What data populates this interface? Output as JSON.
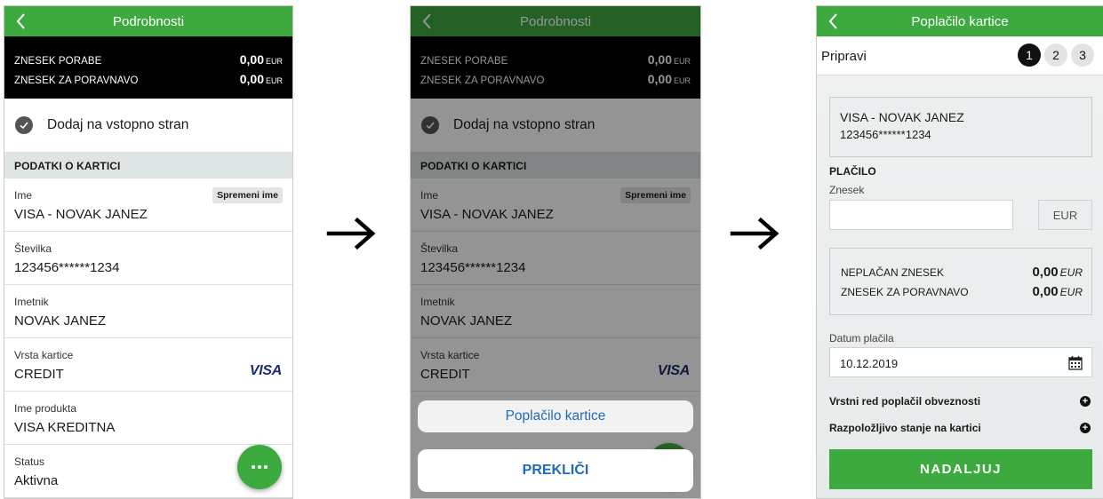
{
  "screen1": {
    "title": "Podrobnosti",
    "summary": [
      {
        "label": "ZNESEK PORABE",
        "value": "0,00",
        "currency": "EUR"
      },
      {
        "label": "ZNESEK ZA PORAVNAVO",
        "value": "0,00",
        "currency": "EUR"
      }
    ],
    "add_to_home": "Dodaj na vstopno stran",
    "section_title": "PODATKI O KARTICI",
    "rename_label": "Spremeni ime",
    "card_brand": "VISA",
    "fields": [
      {
        "label": "Ime",
        "value": "VISA - NOVAK JANEZ"
      },
      {
        "label": "Številka",
        "value": "123456******1234"
      },
      {
        "label": "Imetnik",
        "value": "NOVAK JANEZ"
      },
      {
        "label": "Vrsta kartice",
        "value": "CREDIT"
      },
      {
        "label": "Ime produkta",
        "value": "VISA KREDITNA"
      },
      {
        "label": "Status",
        "value": "Aktivna"
      }
    ]
  },
  "screen2": {
    "title": "Podrobnosti",
    "summary": [
      {
        "label": "ZNESEK PORABE",
        "value": "0,00",
        "currency": "EUR"
      },
      {
        "label": "ZNESEK ZA PORAVNAVO",
        "value": "0,00",
        "currency": "EUR"
      }
    ],
    "add_to_home": "Dodaj na vstopno stran",
    "section_title": "PODATKI O KARTICI",
    "rename_label": "Spremeni ime",
    "card_brand": "VISA",
    "fields": [
      {
        "label": "Ime",
        "value": "VISA - NOVAK JANEZ"
      },
      {
        "label": "Številka",
        "value": "123456******1234"
      },
      {
        "label": "Imetnik",
        "value": "NOVAK JANEZ"
      },
      {
        "label": "Vrsta kartice",
        "value": "CREDIT"
      }
    ],
    "action_sheet": {
      "option": "Poplačilo kartice",
      "cancel": "PREKLIČI"
    }
  },
  "screen3": {
    "title": "Poplačilo kartice",
    "step_label": "Pripravi",
    "steps": [
      "1",
      "2",
      "3"
    ],
    "active_step": 1,
    "recipient_line1": "VISA - NOVAK JANEZ",
    "recipient_line2": "123456******1234",
    "payment_section": "PLAČILO",
    "amount_label": "Znesek",
    "amount_value": "",
    "currency": "EUR",
    "unpaid": {
      "label": "NEPLAČAN ZNESEK",
      "value": "0,00",
      "currency": "EUR"
    },
    "to_settle": {
      "label": "ZNESEK ZA PORAVNAVO",
      "value": "0,00",
      "currency": "EUR"
    },
    "date_label": "Datum plačila",
    "date_value": "10.12.2019",
    "expanders": [
      "Vrstni red poplačil obveznosti",
      "Razpoložljivo stanje na kartici"
    ],
    "continue_button": "NADALJUJ"
  },
  "colors": {
    "brand_green": "#3daa3f",
    "link_blue": "#1e6bbd",
    "visa_navy": "#1a2e6b"
  }
}
